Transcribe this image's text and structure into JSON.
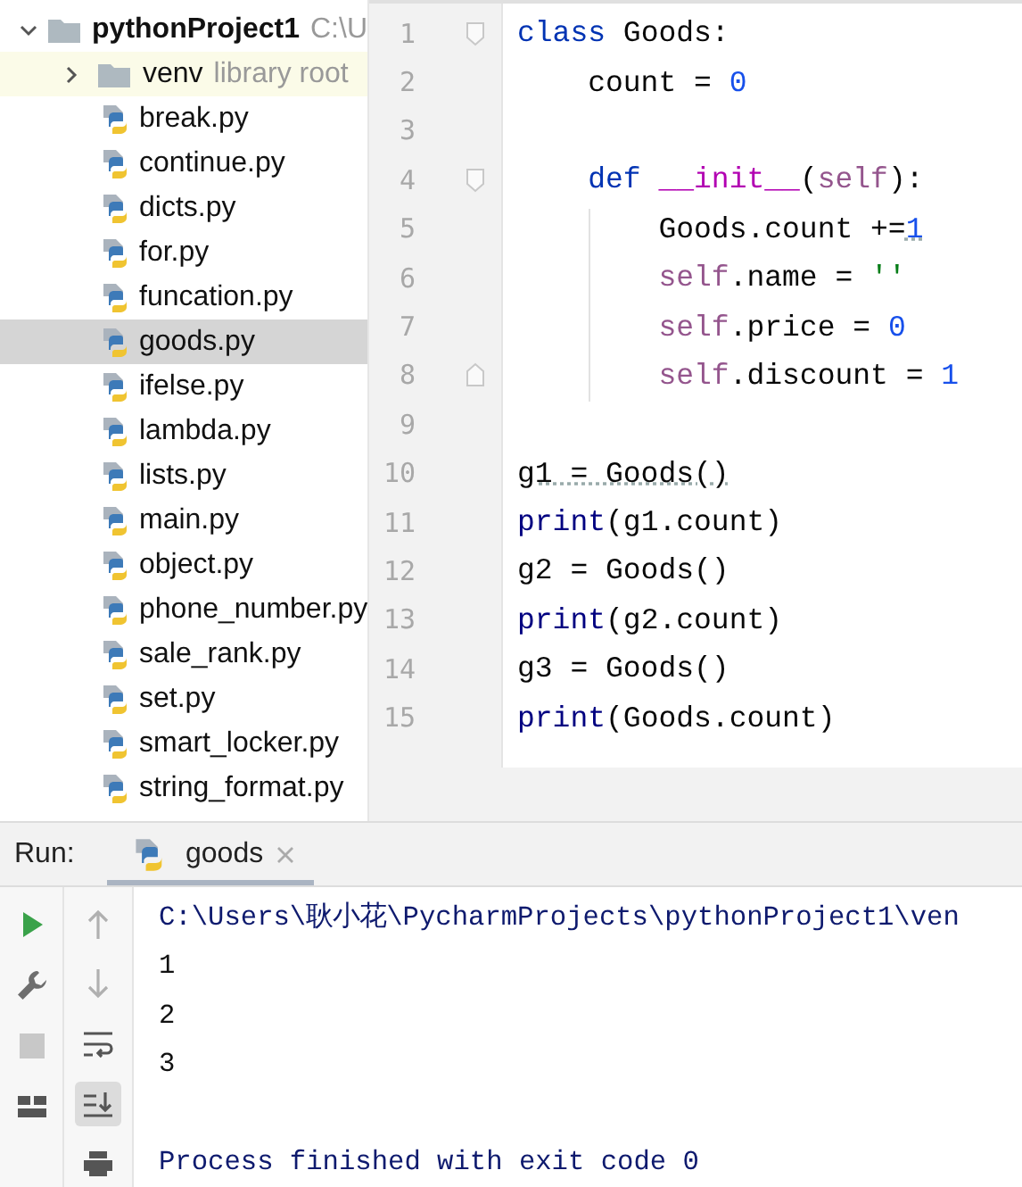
{
  "project_tree": {
    "root": {
      "name": "pythonProject1",
      "path": "C:\\U",
      "expanded": true,
      "children": [
        {
          "kind": "folder",
          "name": "venv",
          "note": "library root",
          "expanded": false,
          "selected": false
        },
        {
          "kind": "python",
          "name": "break.py",
          "selected": false
        },
        {
          "kind": "python",
          "name": "continue.py",
          "selected": false
        },
        {
          "kind": "python",
          "name": "dicts.py",
          "selected": false
        },
        {
          "kind": "python",
          "name": "for.py",
          "selected": false
        },
        {
          "kind": "python",
          "name": "funcation.py",
          "selected": false
        },
        {
          "kind": "python",
          "name": "goods.py",
          "selected": true
        },
        {
          "kind": "python",
          "name": "ifelse.py",
          "selected": false
        },
        {
          "kind": "python",
          "name": "lambda.py",
          "selected": false
        },
        {
          "kind": "python",
          "name": "lists.py",
          "selected": false
        },
        {
          "kind": "python",
          "name": "main.py",
          "selected": false
        },
        {
          "kind": "python",
          "name": "object.py",
          "selected": false
        },
        {
          "kind": "python",
          "name": "phone_number.py",
          "selected": false
        },
        {
          "kind": "python",
          "name": "sale_rank.py",
          "selected": false
        },
        {
          "kind": "python",
          "name": "set.py",
          "selected": false
        },
        {
          "kind": "python",
          "name": "smart_locker.py",
          "selected": false
        },
        {
          "kind": "python",
          "name": "string_format.py",
          "selected": false
        }
      ]
    }
  },
  "editor": {
    "lines": [
      {
        "number": "1",
        "kind": "fold-start",
        "tokens": [
          {
            "kind": "keyword",
            "text": "class "
          },
          {
            "kind": "plain",
            "text": "Goods:"
          }
        ]
      },
      {
        "number": "2",
        "kind": "plain",
        "tokens": [
          {
            "kind": "plain",
            "text": "    count = "
          },
          {
            "kind": "number",
            "text": "0"
          }
        ]
      },
      {
        "number": "3",
        "kind": "plain"
      },
      {
        "number": "4",
        "kind": "fold-start",
        "tokens": [
          {
            "kind": "keyword",
            "text": "    def "
          },
          {
            "kind": "magic",
            "text": "__init__"
          },
          {
            "kind": "plain",
            "text": "("
          },
          {
            "kind": "self",
            "text": "self"
          },
          {
            "kind": "plain",
            "text": "):"
          }
        ]
      },
      {
        "number": "5",
        "kind": "plain",
        "tokens": [
          {
            "kind": "plain",
            "text": "        Goods.count +="
          },
          {
            "kind": "number",
            "text": "1",
            "underline": true
          }
        ]
      },
      {
        "number": "6",
        "kind": "plain",
        "tokens": [
          {
            "kind": "self",
            "text": "        self"
          },
          {
            "kind": "plain",
            "text": ".name = "
          },
          {
            "kind": "string",
            "text": "''"
          }
        ]
      },
      {
        "number": "7",
        "kind": "plain",
        "tokens": [
          {
            "kind": "self",
            "text": "        self"
          },
          {
            "kind": "plain",
            "text": ".price = "
          },
          {
            "kind": "number",
            "text": "0"
          }
        ]
      },
      {
        "number": "8",
        "kind": "fold-end",
        "tokens": [
          {
            "kind": "self",
            "text": "        self"
          },
          {
            "kind": "plain",
            "text": ".discount = "
          },
          {
            "kind": "number",
            "text": "1"
          }
        ]
      },
      {
        "number": "9",
        "kind": "plain"
      },
      {
        "number": "10",
        "kind": "plain",
        "tokens": [
          {
            "kind": "plain",
            "text": "g1 = Goods()",
            "underline": true
          }
        ]
      },
      {
        "number": "11",
        "kind": "plain",
        "tokens": [
          {
            "kind": "builtin",
            "text": "print"
          },
          {
            "kind": "plain",
            "text": "(g1.count)"
          }
        ]
      },
      {
        "number": "12",
        "kind": "plain",
        "tokens": [
          {
            "kind": "plain",
            "text": "g2 = Goods()"
          }
        ]
      },
      {
        "number": "13",
        "kind": "plain",
        "tokens": [
          {
            "kind": "builtin",
            "text": "print"
          },
          {
            "kind": "plain",
            "text": "(g2.count)"
          }
        ]
      },
      {
        "number": "14",
        "kind": "plain",
        "tokens": [
          {
            "kind": "plain",
            "text": "g3 = Goods()"
          }
        ]
      },
      {
        "number": "15",
        "kind": "plain",
        "tokens": [
          {
            "kind": "builtin",
            "text": "print"
          },
          {
            "kind": "plain",
            "text": "(Goods.count)"
          }
        ]
      }
    ]
  },
  "run": {
    "label": "Run:",
    "tabs": [
      {
        "label": "goods",
        "selected": true
      }
    ],
    "left_tools": [
      {
        "kind": "run"
      },
      {
        "kind": "wrench"
      },
      {
        "kind": "stop"
      },
      {
        "kind": "layout"
      }
    ],
    "right_tools": [
      {
        "kind": "up",
        "selected": false
      },
      {
        "kind": "down",
        "selected": false
      },
      {
        "kind": "wrap",
        "selected": false
      },
      {
        "kind": "scroll-end",
        "selected": true
      },
      {
        "kind": "print",
        "selected": false
      }
    ],
    "output": [
      {
        "kind": "command",
        "text": "C:\\Users\\耿小花\\PycharmProjects\\pythonProject1\\ven"
      },
      {
        "kind": "out",
        "text": "1"
      },
      {
        "kind": "out",
        "text": "2"
      },
      {
        "kind": "out",
        "text": "3"
      },
      {
        "kind": "exit",
        "text": "Process finished with exit code 0"
      }
    ]
  }
}
